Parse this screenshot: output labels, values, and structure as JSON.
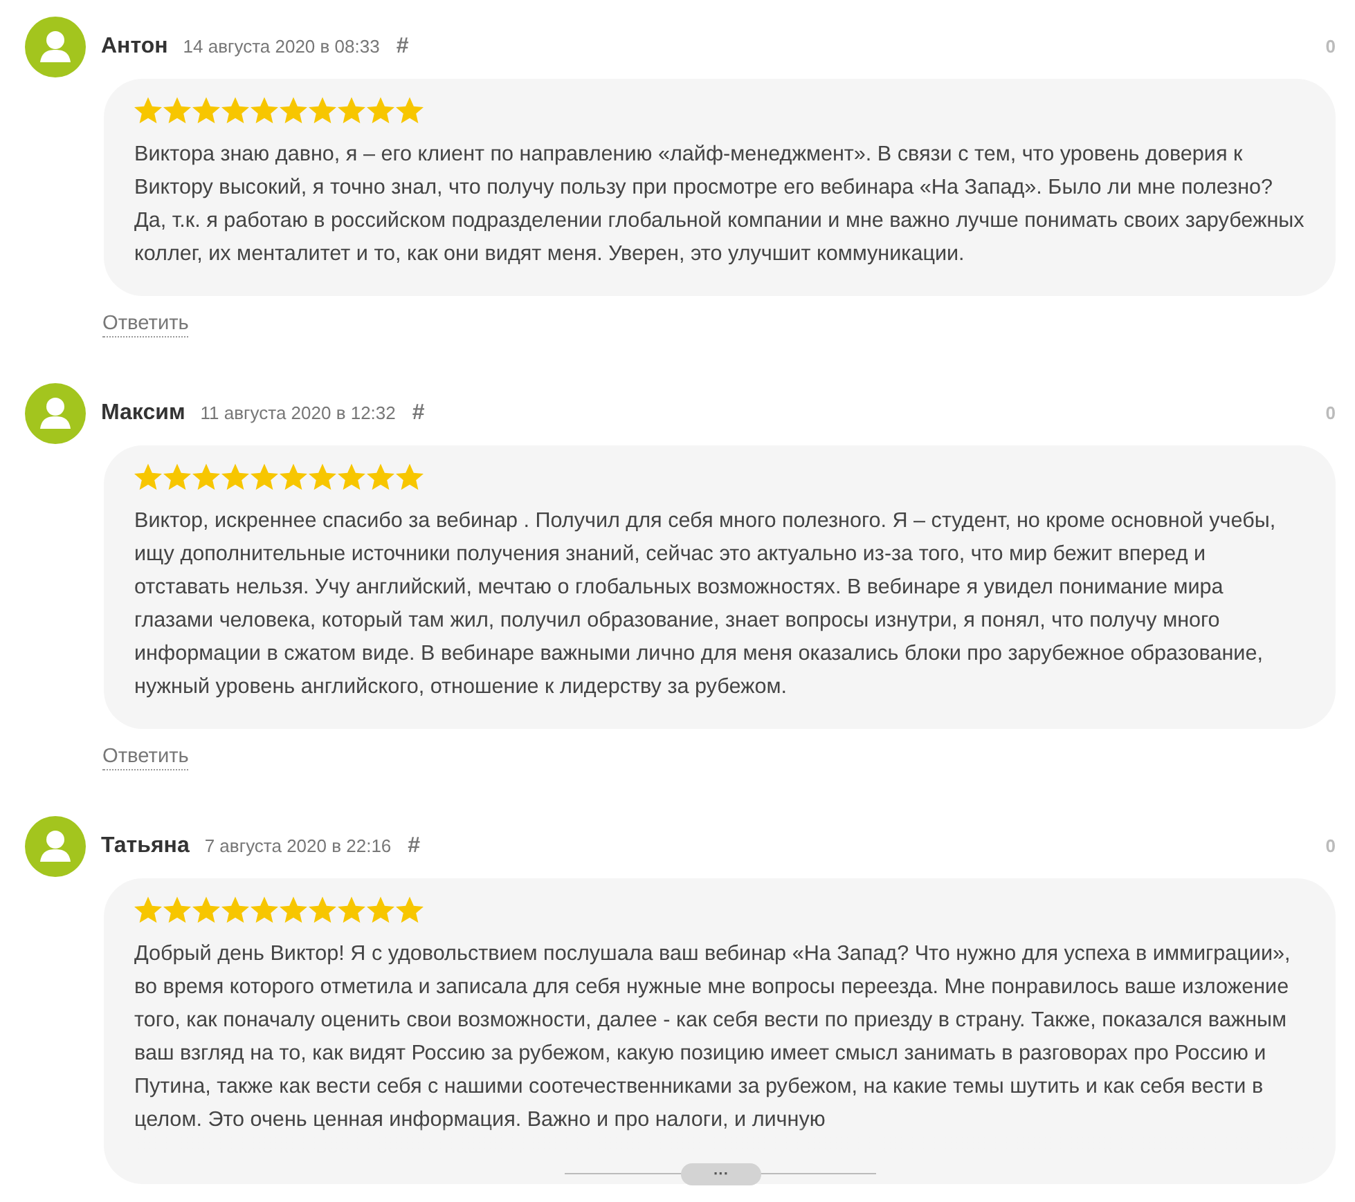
{
  "comments": [
    {
      "author": "Антон",
      "date": "14 августа 2020 в 08:33",
      "anchor": "#",
      "votes": "0",
      "stars": 10,
      "text": "Виктора знаю давно, я – его клиент по направлению «лайф-менеджмент». В связи с тем, что уровень доверия к Виктору высокий, я точно знал, что получу пользу при просмотре его вебинара «На Запад». Было ли мне полезно? Да, т.к. я работаю в российском подразделении глобальной компании и мне важно лучше понимать своих зарубежных коллег, их менталитет и то, как они видят меня. Уверен, это улучшит коммуникации.",
      "collapsed": false,
      "reply": "Ответить"
    },
    {
      "author": "Максим",
      "date": "11 августа 2020 в 12:32",
      "anchor": "#",
      "votes": "0",
      "stars": 10,
      "text": "Виктор, искреннее спасибо за вебинар . Получил для себя много полезного. Я – студент, но кроме основной учебы, ищу дополнительные источники получения знаний, сейчас это актуально из-за того, что мир бежит вперед и отставать нельзя. Учу английский, мечтаю о глобальных возможностях. В вебинаре я увидел понимание мира глазами человека, который там жил, получил образование, знает вопросы изнутри, я понял, что получу много информации в сжатом виде. В вебинаре важными лично для меня оказались блоки про зарубежное образование, нужный уровень английского, отношение к лидерству за рубежом.",
      "collapsed": false,
      "reply": "Ответить"
    },
    {
      "author": "Татьяна",
      "date": "7 августа 2020 в 22:16",
      "anchor": "#",
      "votes": "0",
      "stars": 10,
      "text": "Добрый день Виктор! Я с удовольствием послушала ваш вебинар «На Запад? Что нужно для успеха в иммиграции», во время которого отметила и записала для себя нужные мне вопросы переезда. Мне понравилось ваше изложение того, как поначалу оценить свои возможности, далее - как себя вести по приезду в страну. Также, показался важным ваш взгляд на то, как видят Россию за рубежом, какую позицию имеет смысл занимать в разговорах про Россию и Путина, также как вести себя с нашими соотечественниками за рубежом, на какие темы шутить и как себя вести в целом. Это очень ценная информация. Важно и про налоги, и личную",
      "collapsed": true,
      "expand": "···"
    }
  ]
}
